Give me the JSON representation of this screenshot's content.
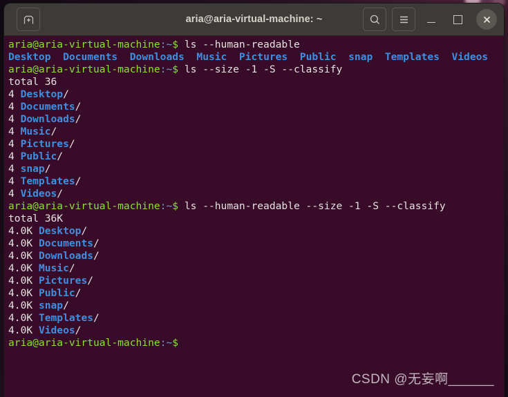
{
  "window": {
    "title": "aria@aria-virtual-machine: ~",
    "titlebar_bg": "#3c3b37",
    "terminal_bg": "#380c28",
    "new_tab_label": "New Tab",
    "search_label": "Search",
    "menu_label": "Menu",
    "minimize_label": "Minimize",
    "maximize_label": "Maximize",
    "close_label": "Close"
  },
  "prompt": {
    "user_host": "aria@aria-virtual-machine",
    "colon": ":",
    "path": "~",
    "dollar": "$"
  },
  "commands": {
    "cmd1": " ls --human-readable",
    "cmd2": " ls --size -1 -S --classify",
    "cmd3": " ls --human-readable --size -1 -S --classify"
  },
  "output": {
    "listing_row": [
      "Desktop",
      "Documents",
      "Downloads",
      "Music",
      "Pictures",
      "Public",
      "snap",
      "Templates",
      "Videos"
    ],
    "total_plain": "total 36",
    "total_human": "total 36K",
    "size_plain": "4",
    "size_human": "4.0K",
    "entries": [
      {
        "name": "Desktop",
        "suffix": "/"
      },
      {
        "name": "Documents",
        "suffix": "/"
      },
      {
        "name": "Downloads",
        "suffix": "/"
      },
      {
        "name": "Music",
        "suffix": "/"
      },
      {
        "name": "Pictures",
        "suffix": "/"
      },
      {
        "name": "Public",
        "suffix": "/"
      },
      {
        "name": "snap",
        "suffix": "/"
      },
      {
        "name": "Templates",
        "suffix": "/"
      },
      {
        "name": "Videos",
        "suffix": "/"
      }
    ]
  },
  "watermark": {
    "text": "CSDN @无妄啊______"
  },
  "colors": {
    "prompt_green": "#8ae234",
    "path_blue": "#729fcf",
    "dir_blue": "#3f8fe0",
    "text_white": "#e6e2e0",
    "terminal_bg": "#380c28",
    "titlebar_bg": "#3c3b37"
  }
}
